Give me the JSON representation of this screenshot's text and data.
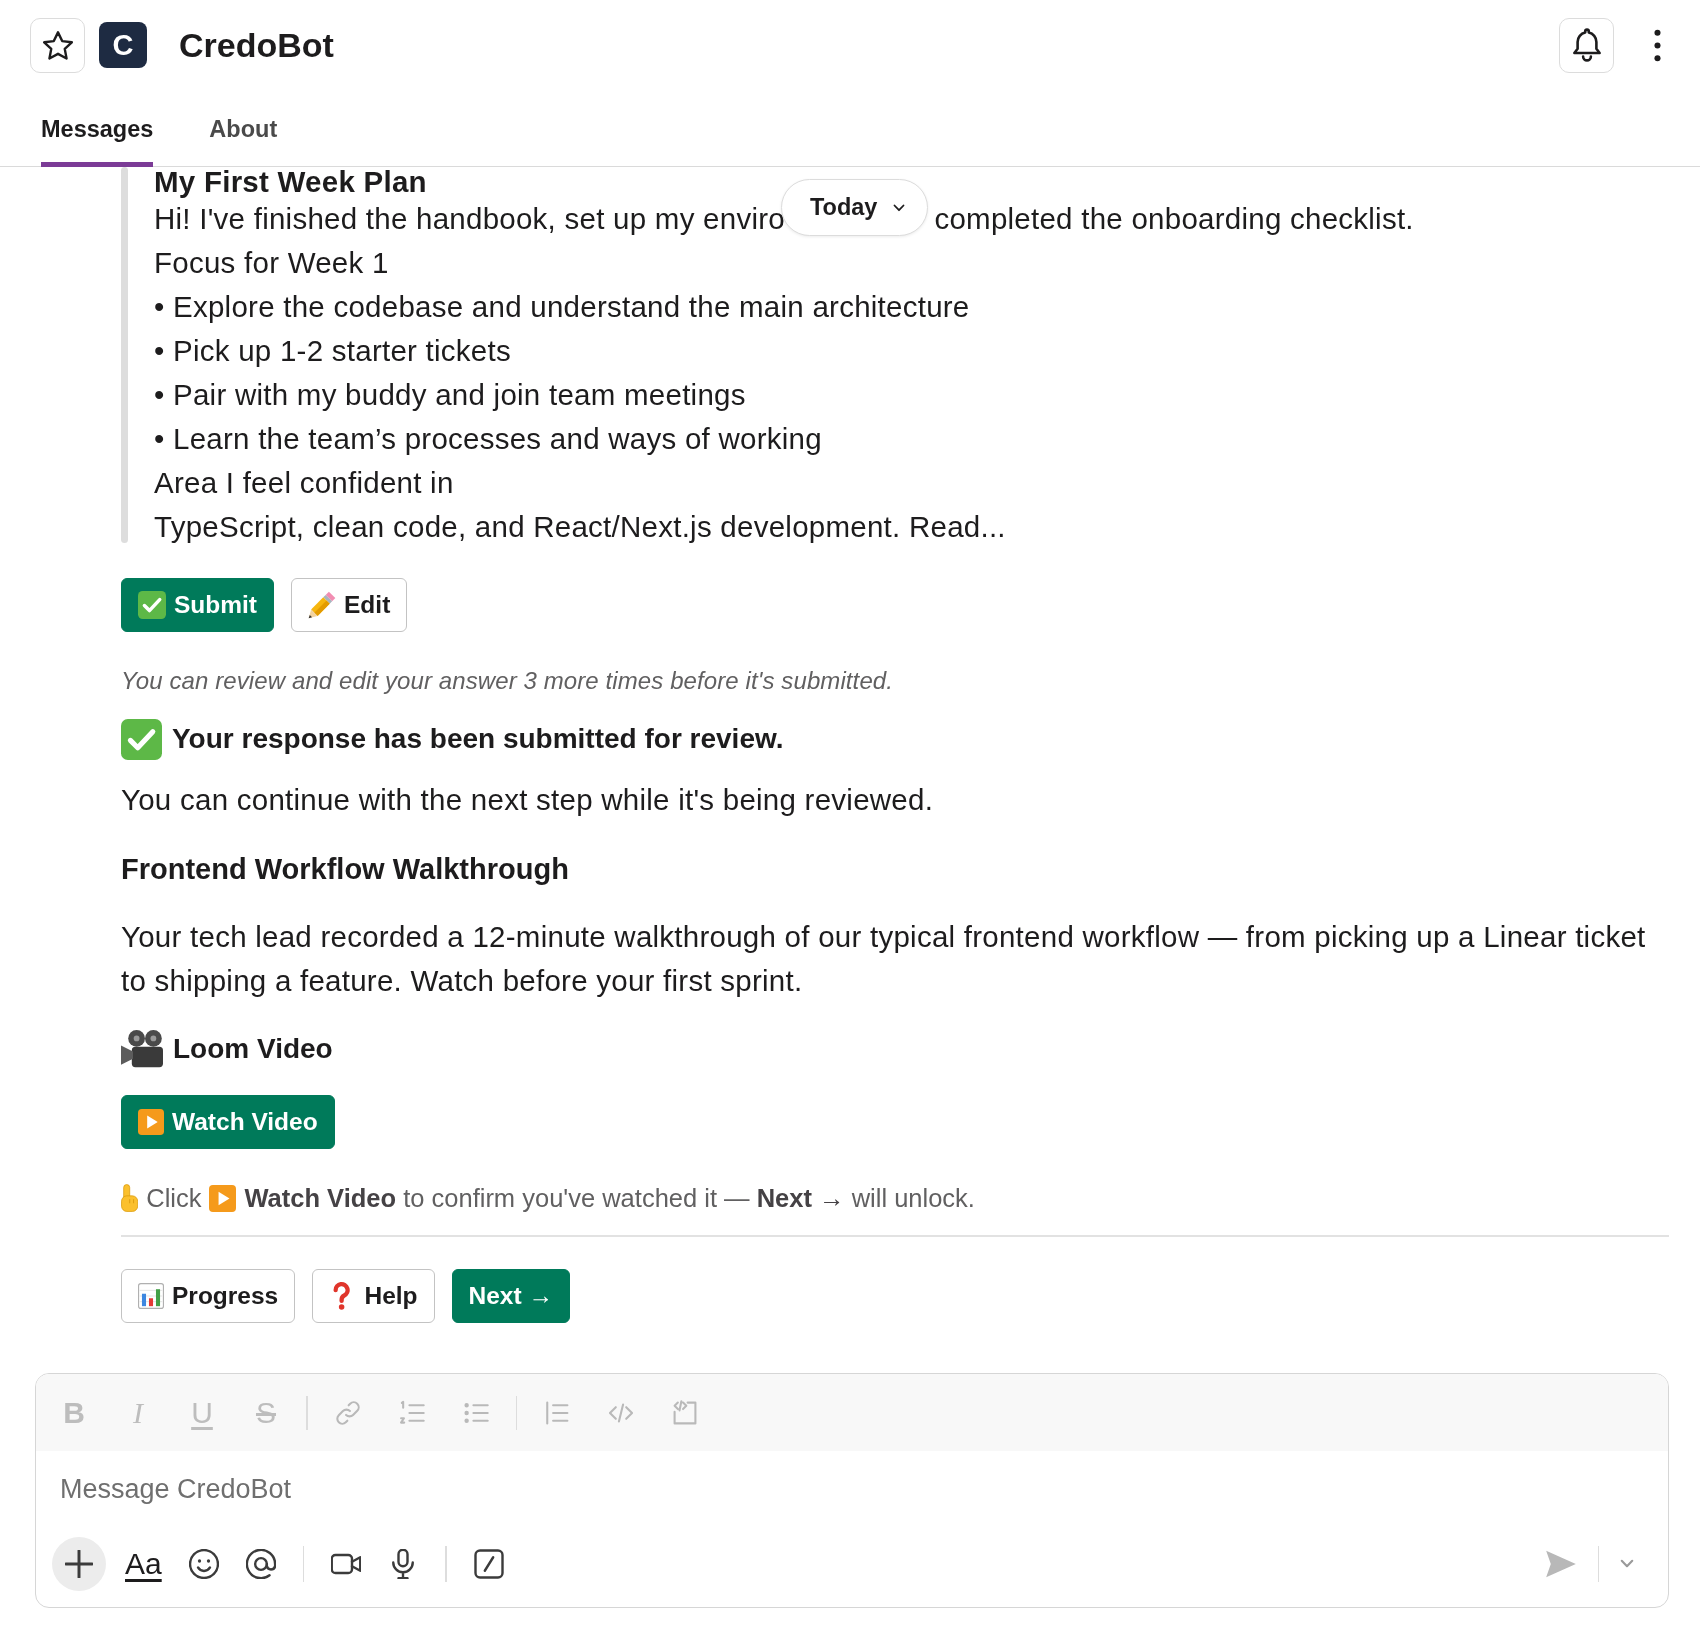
{
  "header": {
    "starred": false,
    "logo_letter": "C",
    "title": "CredoBot"
  },
  "tabs": [
    {
      "label": "Messages",
      "selected": true
    },
    {
      "label": "About",
      "selected": false
    }
  ],
  "date_divider": {
    "label": "Today"
  },
  "message": {
    "quote": {
      "title": "My First Week Plan",
      "lines": [
        {
          "parts": [
            "Hi! I've finished the handbook, set up my enviro",
            "completed the onboarding checklist."
          ]
        },
        {
          "parts": [
            "Focus for Week 1"
          ]
        },
        {
          "parts": [
            "• Explore the codebase and understand the main architecture"
          ]
        },
        {
          "parts": [
            "• Pick up 1-2 starter tickets"
          ]
        },
        {
          "parts": [
            "• Pair with my buddy and join team meetings"
          ]
        },
        {
          "parts": [
            "• Learn the team’s processes and ways of working"
          ]
        },
        {
          "parts": [
            "Area I feel confident in"
          ]
        },
        {
          "parts": [
            "TypeScript, clean code, and React/Next.js development. Read..."
          ]
        }
      ]
    },
    "actions": [
      {
        "kind": "submit",
        "label": "Submit"
      },
      {
        "kind": "edit",
        "label": "Edit"
      }
    ],
    "note": "You can review and edit your answer 3 more times before it's submitted.",
    "status": "Your response has been submitted for review.",
    "status_detail": "You can continue with the next step while it's being reviewed.",
    "section_title": "Frontend Workflow Walkthrough",
    "section_body": "Your tech lead recorded a 12-minute walkthrough of our typical frontend workflow — from picking up a Linear ticket to shipping a feature. Watch before your first sprint.",
    "video_title": "Loom Video",
    "video_actions": [
      {
        "kind": "watch",
        "label": "Watch Video"
      }
    ],
    "hint": {
      "before": "Click",
      "after": "**Watch Video** to confirm you've watched it — **Next →** will unlock."
    },
    "nav_buttons": [
      {
        "kind": "progress",
        "label": "Progress"
      },
      {
        "kind": "help",
        "label": "Help"
      },
      {
        "kind": "next",
        "label": "Next →"
      }
    ]
  },
  "composer": {
    "formatting": [
      {
        "kind": "bold",
        "label": "B"
      },
      {
        "kind": "italic",
        "label": "I"
      },
      {
        "kind": "underline",
        "label": "U"
      },
      {
        "kind": "strike",
        "label": "S"
      }
    ],
    "placeholder": "Message CredoBot",
    "text_format_label": "Aa"
  }
}
